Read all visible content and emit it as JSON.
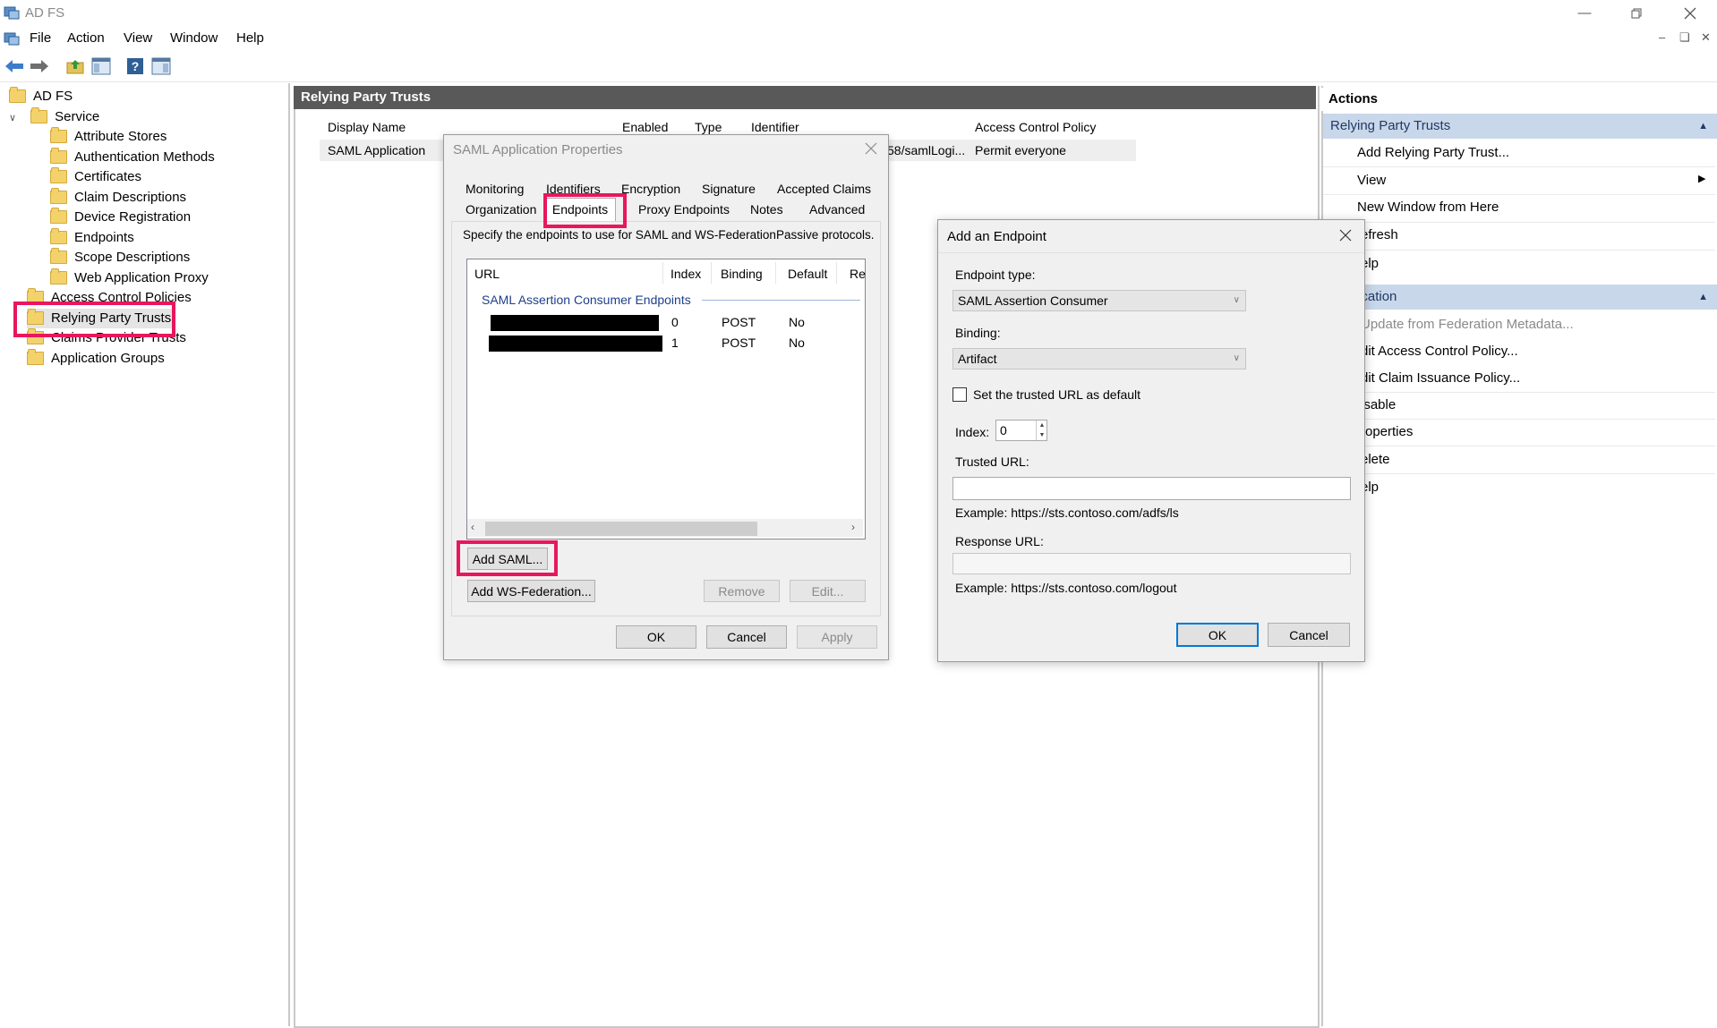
{
  "window": {
    "title": "AD FS"
  },
  "menu": [
    "File",
    "Action",
    "View",
    "Window",
    "Help"
  ],
  "tree": {
    "root": "AD FS",
    "service": "Service",
    "service_children": [
      "Attribute Stores",
      "Authentication Methods",
      "Certificates",
      "Claim Descriptions",
      "Device Registration",
      "Endpoints",
      "Scope Descriptions",
      "Web Application Proxy"
    ],
    "top_items": [
      "Access Control Policies",
      "Relying Party Trusts",
      "Claims Provider Trusts",
      "Application Groups"
    ]
  },
  "center": {
    "header": "Relying Party Trusts",
    "columns": [
      "Display Name",
      "Enabled",
      "Type",
      "Identifier",
      "Access Control Policy"
    ],
    "row": {
      "display_name": "SAML Application",
      "identifier_tail": "58/samlLogi...",
      "policy": "Permit everyone"
    }
  },
  "actions": {
    "header": "Actions",
    "section1": "Relying Party Trusts",
    "section1_items": [
      "Add Relying Party Trust...",
      "View",
      "New Window from Here",
      "efresh",
      "elp"
    ],
    "section2": "Application",
    "section2_items": [
      "Update from Federation Metadata...",
      "dit Access Control Policy...",
      "dit Claim Issuance Policy...",
      "isable",
      "roperties",
      "elete",
      "elp"
    ]
  },
  "props_dialog": {
    "title": "SAML Application Properties",
    "tabs_row1": [
      "Monitoring",
      "Identifiers",
      "Encryption",
      "Signature",
      "Accepted Claims"
    ],
    "tabs_row2": [
      "Organization",
      "Endpoints",
      "Proxy Endpoints",
      "Notes",
      "Advanced"
    ],
    "instruction": "Specify the endpoints to use for SAML and WS-FederationPassive protocols.",
    "list_columns": [
      "URL",
      "Index",
      "Binding",
      "Default",
      "Re"
    ],
    "group_label": "SAML Assertion Consumer Endpoints",
    "rows": [
      {
        "index": "0",
        "binding": "POST",
        "default": "No"
      },
      {
        "index": "1",
        "binding": "POST",
        "default": "No"
      }
    ],
    "add_saml": "Add SAML...",
    "add_wsfed": "Add WS-Federation...",
    "remove": "Remove",
    "edit": "Edit...",
    "ok": "OK",
    "cancel": "Cancel",
    "apply": "Apply"
  },
  "add_endpoint": {
    "title": "Add an Endpoint",
    "endpoint_type_label": "Endpoint type:",
    "endpoint_type_value": "SAML Assertion Consumer",
    "binding_label": "Binding:",
    "binding_value": "Artifact",
    "default_checkbox": "Set the trusted URL as default",
    "index_label": "Index:",
    "index_value": "0",
    "trusted_url_label": "Trusted URL:",
    "trusted_url_example": "Example: https://sts.contoso.com/adfs/ls",
    "response_url_label": "Response URL:",
    "response_url_example": "Example: https://sts.contoso.com/logout",
    "ok": "OK",
    "cancel": "Cancel"
  },
  "colors": {
    "highlight": "#e8175d",
    "selection": "#c9d7ea",
    "header_dark": "#595959"
  }
}
